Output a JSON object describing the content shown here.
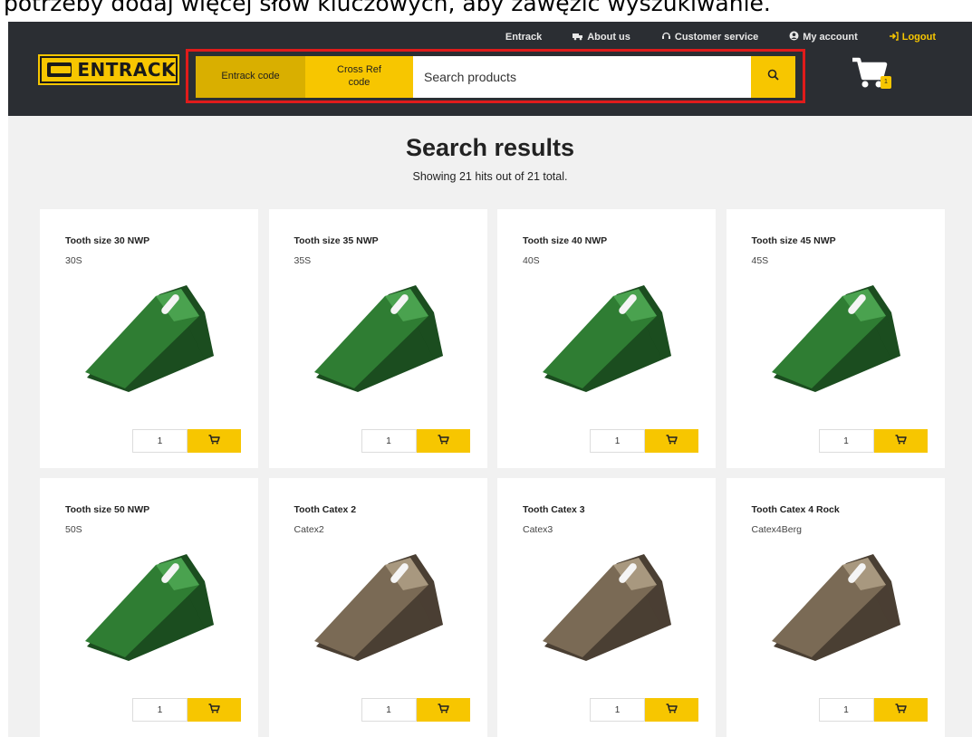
{
  "caption": "potrzeby dodaj więcej słów kluczowych, aby zawęzić wyszukiwanie.",
  "header": {
    "logo_text": "ENTRACK",
    "nav": [
      {
        "label": "Entrack",
        "icon": "none"
      },
      {
        "label": "About us",
        "icon": "truck-icon"
      },
      {
        "label": "Customer service",
        "icon": "headset-icon"
      },
      {
        "label": "My account",
        "icon": "user-circle-icon"
      },
      {
        "label": "Logout",
        "icon": "logout-icon"
      }
    ],
    "search": {
      "mode_entrack": "Entrack code",
      "mode_crossref": "Cross Ref code",
      "placeholder": "Search products"
    },
    "cart_count": "1"
  },
  "main": {
    "title": "Search results",
    "subtitle": "Showing 21 hits out of 21 total."
  },
  "products": [
    {
      "name": "Tooth size 30 NWP",
      "code": "30S",
      "qty": "1",
      "finish": "green"
    },
    {
      "name": "Tooth size 35 NWP",
      "code": "35S",
      "qty": "1",
      "finish": "green"
    },
    {
      "name": "Tooth size 40 NWP",
      "code": "40S",
      "qty": "1",
      "finish": "green"
    },
    {
      "name": "Tooth size 45 NWP",
      "code": "45S",
      "qty": "1",
      "finish": "green"
    },
    {
      "name": "Tooth size 50 NWP",
      "code": "50S",
      "qty": "1",
      "finish": "green"
    },
    {
      "name": "Tooth Catex 2",
      "code": "Catex2",
      "qty": "1",
      "finish": "bronze"
    },
    {
      "name": "Tooth Catex 3",
      "code": "Catex3",
      "qty": "1",
      "finish": "bronze"
    },
    {
      "name": "Tooth Catex 4 Rock",
      "code": "Catex4Berg",
      "qty": "1",
      "finish": "bronze"
    }
  ],
  "colors": {
    "accent": "#f7c600",
    "accent_dark": "#d9af00",
    "header_bg": "#2b2e33",
    "highlight_border": "#e01b1b",
    "tooth_green": "#2f7d33",
    "tooth_bronze": "#7a6a55"
  }
}
